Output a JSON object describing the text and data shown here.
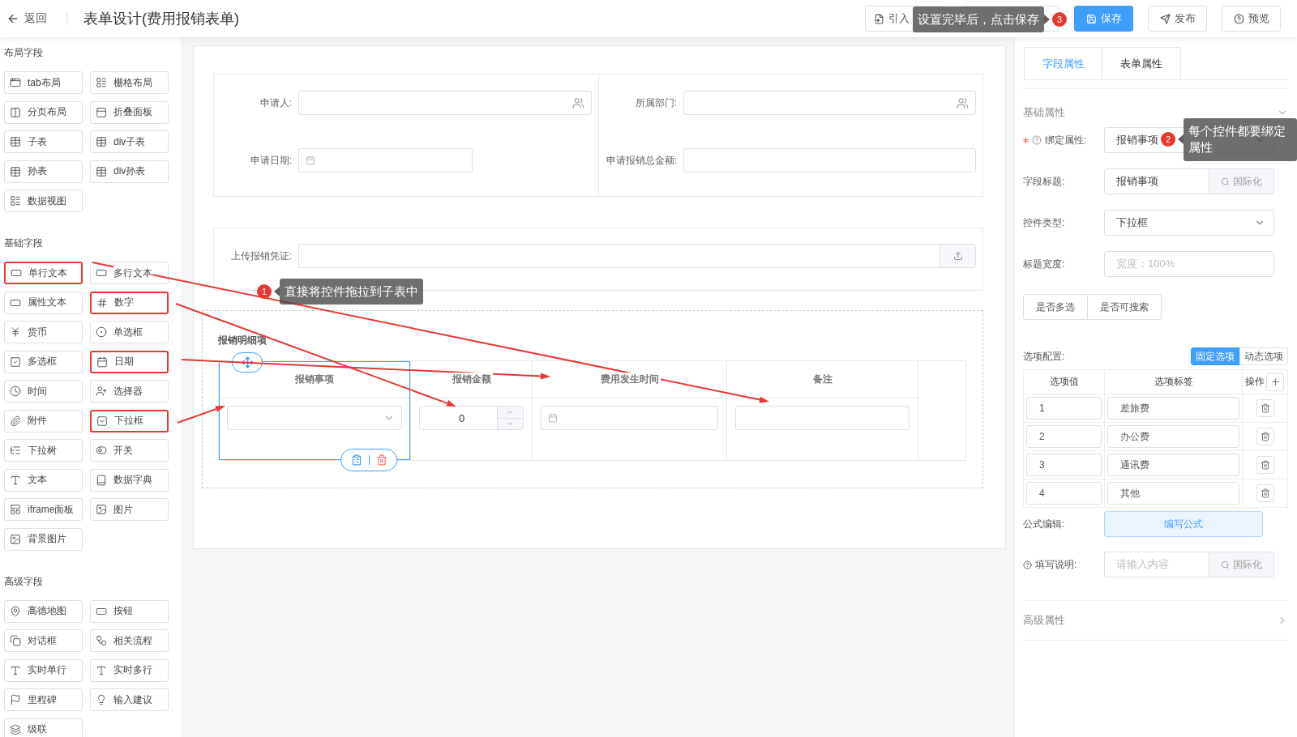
{
  "header": {
    "back": "返回",
    "title": "表单设计(费用报销表单)",
    "buttons": [
      {
        "kind": "default",
        "label": "引入"
      },
      {
        "kind": "hidden"
      },
      {
        "kind": "primary",
        "label": "保存"
      },
      {
        "kind": "default",
        "label": "发布"
      },
      {
        "kind": "default",
        "label": "预览"
      }
    ]
  },
  "palette": [
    {
      "title": "布局字段",
      "items": [
        {
          "label": "tab布局",
          "highlighted": false
        },
        {
          "label": "栅格布局",
          "highlighted": false
        },
        {
          "label": "分页布局",
          "highlighted": false
        },
        {
          "label": "折叠面板",
          "highlighted": false
        },
        {
          "label": "子表",
          "highlighted": false
        },
        {
          "label": "div子表",
          "highlighted": false
        },
        {
          "label": "孙表",
          "highlighted": false
        },
        {
          "label": "div孙表",
          "highlighted": false
        },
        {
          "label": "数据视图",
          "highlighted": false
        }
      ]
    },
    {
      "title": "基础字段",
      "items": [
        {
          "label": "单行文本",
          "highlighted": true
        },
        {
          "label": "多行文本",
          "highlighted": false
        },
        {
          "label": "属性文本",
          "highlighted": false
        },
        {
          "label": "数字",
          "highlighted": true
        },
        {
          "label": "货币",
          "highlighted": false
        },
        {
          "label": "单选框",
          "highlighted": false
        },
        {
          "label": "多选框",
          "highlighted": false
        },
        {
          "label": "日期",
          "highlighted": true
        },
        {
          "label": "时间",
          "highlighted": false
        },
        {
          "label": "选择器",
          "highlighted": false
        },
        {
          "label": "附件",
          "highlighted": false
        },
        {
          "label": "下拉框",
          "highlighted": true
        },
        {
          "label": "下拉树",
          "highlighted": false
        },
        {
          "label": "开关",
          "highlighted": false
        },
        {
          "label": "文本",
          "highlighted": false
        },
        {
          "label": "数据字典",
          "highlighted": false
        },
        {
          "label": "iframe面板",
          "highlighted": false
        },
        {
          "label": "图片",
          "highlighted": false
        },
        {
          "label": "背景图片",
          "highlighted": false
        }
      ]
    },
    {
      "title": "高级字段",
      "items": [
        {
          "label": "高德地图",
          "highlighted": false
        },
        {
          "label": "按钮",
          "highlighted": false
        },
        {
          "label": "对话框",
          "highlighted": false
        },
        {
          "label": "相关流程",
          "highlighted": false
        },
        {
          "label": "实时单行",
          "highlighted": false
        },
        {
          "label": "实时多行",
          "highlighted": false
        },
        {
          "label": "里程碑",
          "highlighted": false
        },
        {
          "label": "输入建议",
          "highlighted": false
        },
        {
          "label": "级联",
          "highlighted": false
        }
      ]
    }
  ],
  "canvas": {
    "grid": [
      [
        {
          "label": "申请人:",
          "kind": "user"
        },
        {
          "label": "申请日期:",
          "kind": "date"
        }
      ],
      [
        {
          "label": "所属部门:",
          "kind": "user"
        },
        {
          "label": "申请报销总金额:",
          "kind": "text"
        }
      ]
    ],
    "upload": {
      "label": "上传报销凭证:"
    },
    "subtable": {
      "title": "报销明细项",
      "columns": [
        {
          "header": "报销事项",
          "kind": "select",
          "selected": true
        },
        {
          "header": "报销金额",
          "kind": "number",
          "value": "0",
          "selected": false
        },
        {
          "header": "费用发生时间",
          "kind": "date",
          "selected": false
        },
        {
          "header": "备注",
          "kind": "text",
          "selected": false
        }
      ]
    }
  },
  "properties": {
    "tabs": [
      {
        "label": "字段属性",
        "selected": true
      },
      {
        "label": "表单属性",
        "selected": false
      }
    ],
    "basic": {
      "title": "基础属性",
      "expanded": true,
      "fields": [
        {
          "label": "绑定属性:",
          "kind": "select",
          "required": true,
          "value": "报销事项"
        },
        {
          "label": "字段标题:",
          "kind": "addon",
          "value": "报销事项",
          "addon": "国际化"
        },
        {
          "label": "控件类型:",
          "kind": "select",
          "required": false,
          "value": "下拉框"
        },
        {
          "label": "标题宽度:",
          "kind": "input",
          "placeholder": "宽度：100%"
        }
      ],
      "toggles": [
        "是否多选",
        "是否可搜索"
      ],
      "options": {
        "label": "选项配置:",
        "modes": [
          {
            "label": "固定选项",
            "selected": true
          },
          {
            "label": "动态选项",
            "selected": false
          }
        ],
        "columns": [
          "选项值",
          "选项标签",
          "操作"
        ],
        "rows": [
          {
            "value": "1",
            "label": "差旅费"
          },
          {
            "value": "2",
            "label": "办公费"
          },
          {
            "value": "3",
            "label": "通讯费"
          },
          {
            "value": "4",
            "label": "其他"
          }
        ]
      },
      "formula": {
        "label": "公式编辑:",
        "button": "编写公式"
      },
      "hint": {
        "label": "填写说明:",
        "placeholder": "请输入内容",
        "addon": "国际化"
      }
    },
    "advanced": {
      "title": "高级属性",
      "expanded": false
    }
  },
  "annotations": [
    {
      "number": "1",
      "text": "直接将控件拖拉到子表中"
    },
    {
      "number": "2",
      "text": "每个控件都要绑定属性"
    },
    {
      "number": "3",
      "text": "设置完毕后，点击保存"
    }
  ]
}
